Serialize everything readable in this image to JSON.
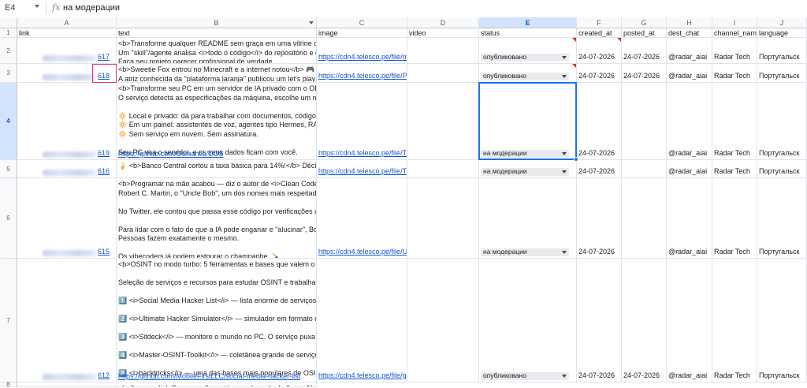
{
  "formula_bar": {
    "name_box": "E4",
    "fx_label": "fx",
    "value": "на модерации"
  },
  "columns": [
    "A",
    "B",
    "C",
    "D",
    "E",
    "F",
    "G",
    "H",
    "I",
    "J"
  ],
  "header_row": {
    "row_number": "1",
    "labels": [
      "link",
      "text",
      "image",
      "video",
      "status",
      "created_at",
      "posted_at",
      "dest_chat",
      "channel_name",
      "language"
    ]
  },
  "rows": [
    {
      "num": "2",
      "link_suffix": "617",
      "text": "<b>Transforme qualquer README sem graça em uma vitrine de projeto</\nUm \"skill\"/agente analisa <i>todo o código</i> do repositório e gera um res\nFaça seu projeto parecer profissional de verdade.",
      "image": "https://cdn4.telesco.pe/file/mHjAxjvffqneqegRtcDzznSdbJ1j1",
      "status": "опубликовано",
      "created_at": "24-07-2026",
      "posted_at": "24-07-2026",
      "dest_chat": "@radar_aiai",
      "channel_name": "Radar Tech",
      "language": "Португальск"
    },
    {
      "num": "3",
      "link_suffix": "618",
      "text": "<b>Sweetie Fox entrou no Minecraft e a internet notou</b> 🎮\nA atriz conhecida da \"plataforma laranja\" publicou um let's play de <i>Mine\nMinecraft segue virando palco universal — até para quem ninguém espera",
      "image": "https://cdn4.telesco.pe/file/PaL2Oks1DSGEw5qWPNlQxnSc",
      "status": "опубликовано",
      "created_at": "24-07-2026",
      "posted_at": "24-07-2026",
      "dest_chat": "@radar_aiai",
      "channel_name": "Radar Tech",
      "language": "Португальск"
    },
    {
      "num": "4",
      "link_text": "https://github.com/Osmantic/ODS",
      "link_suffix": "619",
      "text": "<b>Transforme seu PC em um servidor de IA privado com o ODS</b>\nO serviço detecta as especificações da máquina, escolhe um modelo com\n\n🔅 Local e privado: dá para trabalhar com documentos, código e outros da\n🔅 Em um painel: assistentes de voz, agentes tipo Hermes, RAG, busca,\n🔅 Sem serviço em nuvem. Sem assinatura.\n\nSeu PC vira o servidor, e os seus dados ficam com você.",
      "image": "https://cdn4.telesco.pe/file/T4Ba69NsElqX6E-LmXml0nBy6F",
      "status": "на модерации",
      "created_at": "24-07-2026",
      "posted_at": "",
      "dest_chat": "@radar_aiai",
      "channel_name": "Radar Tech",
      "language": "Португальск"
    },
    {
      "num": "5",
      "link_suffix": "616",
      "text": "🍦 <b>Banco Central cortou a taxa básica para 14%!</b> Décima queda c\n\n😉",
      "image": "https://cdn4.telesco.pe/file/TYKG6PMcY11V9MJPl2gLVhlHn",
      "status": "на модерации",
      "created_at": "24-07-2026",
      "posted_at": "",
      "dest_chat": "@radar_aiai",
      "channel_name": "Radar Tech",
      "language": "Португальск"
    },
    {
      "num": "6",
      "link_suffix": "615",
      "text": "<b>Programar na mão acabou — diz o autor de <i>Clean Code</i> e <i>C\nRobert C. Martin, o \"Uncle Bob\", um dos nomes mais respeitados do softw\n\nNo Twitter, ele contou que passa esse código por verificações automáticas\n\nPara lidar com o fato de que a IA pode enganar e \"alucinar\", Bob é direto:\nPessoas fazem exatamente o mesmo.\n\nOs vibecoders já podem estourar o champanhe. 🍾\nO foco agora é validação — não devoção",
      "image": "https://cdn4.telesco.pe/file/USnvpUF0SLBgDwTfnTtb5kGuG",
      "status": "на модерации",
      "created_at": "24-07-2026",
      "posted_at": "",
      "dest_chat": "@radar_aiai",
      "channel_name": "Radar Tech",
      "language": "Португальск"
    },
    {
      "num": "7",
      "link_text": "https://github.com/MobileFirstLLC/social-media-hacker-list",
      "link_suffix": "612",
      "text": "<b>OSINT no modo turbo: 5 ferramentas e bases que valem o save agora\n\nSeleção de serviços e recursos para estudar OSINT e trabalhar só com fo\n\n1️⃣ <i>Social Media Hacker List</i> — lista enorme de serviços para anális\n\n2️⃣ <i>Ultimate Hacker Simulator</i> — simulador em formato de game qu\n\n3️⃣ <i>Sitdeck</i> — monitore o mundo no PC. O serviço puxa dados de \n\n4️⃣ <i>Master-OSINT-Toolkit</i> — coletânea grande de serviços para inve\n\n5️⃣ <i>hacktricks</i> — uma das bases mais populares de OSINT e hacki\n\nGuarde esta lista — é vantagem real em 2026. 🧠",
      "image": "https://cdn4.telesco.pe/file/gdLgLseJOXMBEsBHN-PE8yl05A",
      "status": "опубликовано",
      "created_at": "24-07-2026",
      "posted_at": "24-07-2026",
      "dest_chat": "@radar_aiai",
      "channel_name": "Radar Tech",
      "language": "Португальск"
    },
    {
      "num": "8",
      "text": "<b>6 новых ligh Supremo</b> está em sol usada de Azure AI alb"
    }
  ]
}
